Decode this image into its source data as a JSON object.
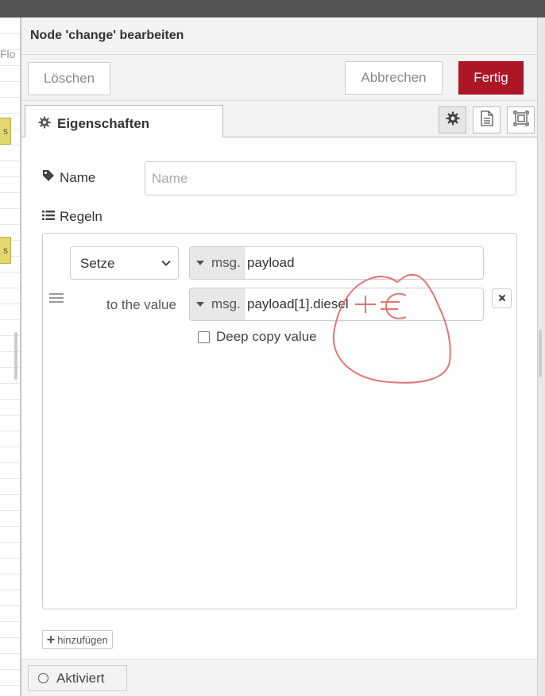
{
  "canvas": {
    "label_fragment": "Flo",
    "node_label": "s"
  },
  "tray": {
    "title": "Node 'change' bearbeiten",
    "buttons": {
      "delete": "Löschen",
      "cancel": "Abbrechen",
      "done": "Fertig"
    }
  },
  "tabs": {
    "properties": "Eigenschaften",
    "icons": [
      "gear-icon",
      "document-icon",
      "expand-icon"
    ]
  },
  "form": {
    "name_label": "Name",
    "name_placeholder": "Name",
    "name_value": "",
    "rules_label": "Regeln",
    "rule": {
      "action": "Setze",
      "target_type": "msg.",
      "target_value": "payload",
      "to_label": "to the value",
      "source_type": "msg.",
      "source_value": "payload[1].diesel",
      "deep_copy_label": "Deep copy value",
      "deep_copy_checked": false
    },
    "add_label": "hinzufügen"
  },
  "footer": {
    "status_label": "Aktiviert"
  },
  "annotation": {
    "handwritten_text": "+€"
  },
  "colors": {
    "accent": "#ad1625",
    "annotation": "#e57373"
  }
}
